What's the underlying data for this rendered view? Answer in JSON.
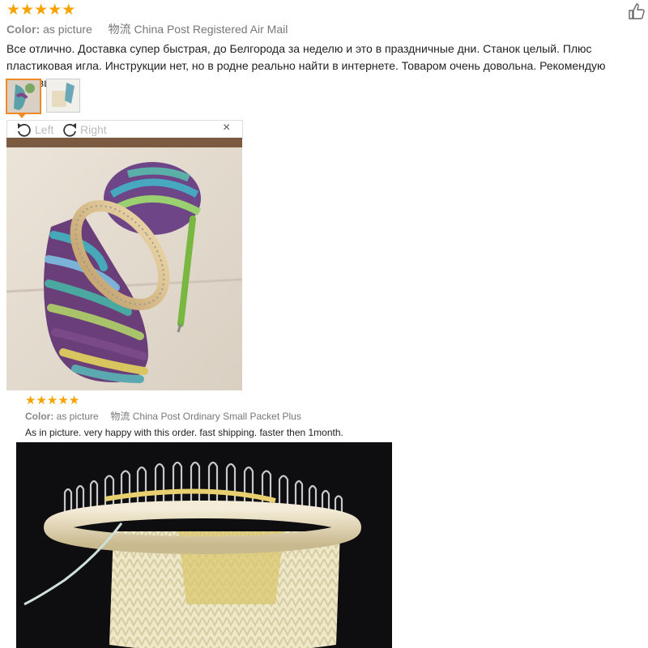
{
  "review1": {
    "stars": [
      "★",
      "★",
      "★",
      "★",
      "★"
    ],
    "color_label": "Color:",
    "color_value": "as picture",
    "shipping_chars": "物流",
    "shipping_value": "China Post Registered Air Mail",
    "text": "Все отлично. Доставка супер быстрая, до Белгорода за неделю и это в праздничные дни. Станок целый. Плюс пластиковая игла. Инструкции нет, но в родне реально найти в интернете. Товаром очень довольна. Рекомендую продавца!!!",
    "viewer": {
      "left_label": "Left",
      "right_label": "Right",
      "close_glyph": "×"
    }
  },
  "review2": {
    "stars": [
      "★",
      "★",
      "★",
      "★",
      "★"
    ],
    "color_label": "Color:",
    "color_value": "as picture",
    "shipping_chars": "物流",
    "shipping_value": "China Post Ordinary Small Packet Plus",
    "text": "As in picture. very happy with this order. fast shipping. faster then 1month."
  },
  "icons": {
    "like": "thumbs-up-icon",
    "rotate_left": "rotate-left-icon",
    "rotate_right": "rotate-right-icon",
    "close": "close-icon"
  },
  "colors": {
    "star": "#f7a200",
    "active_thumb": "#f08a24"
  }
}
